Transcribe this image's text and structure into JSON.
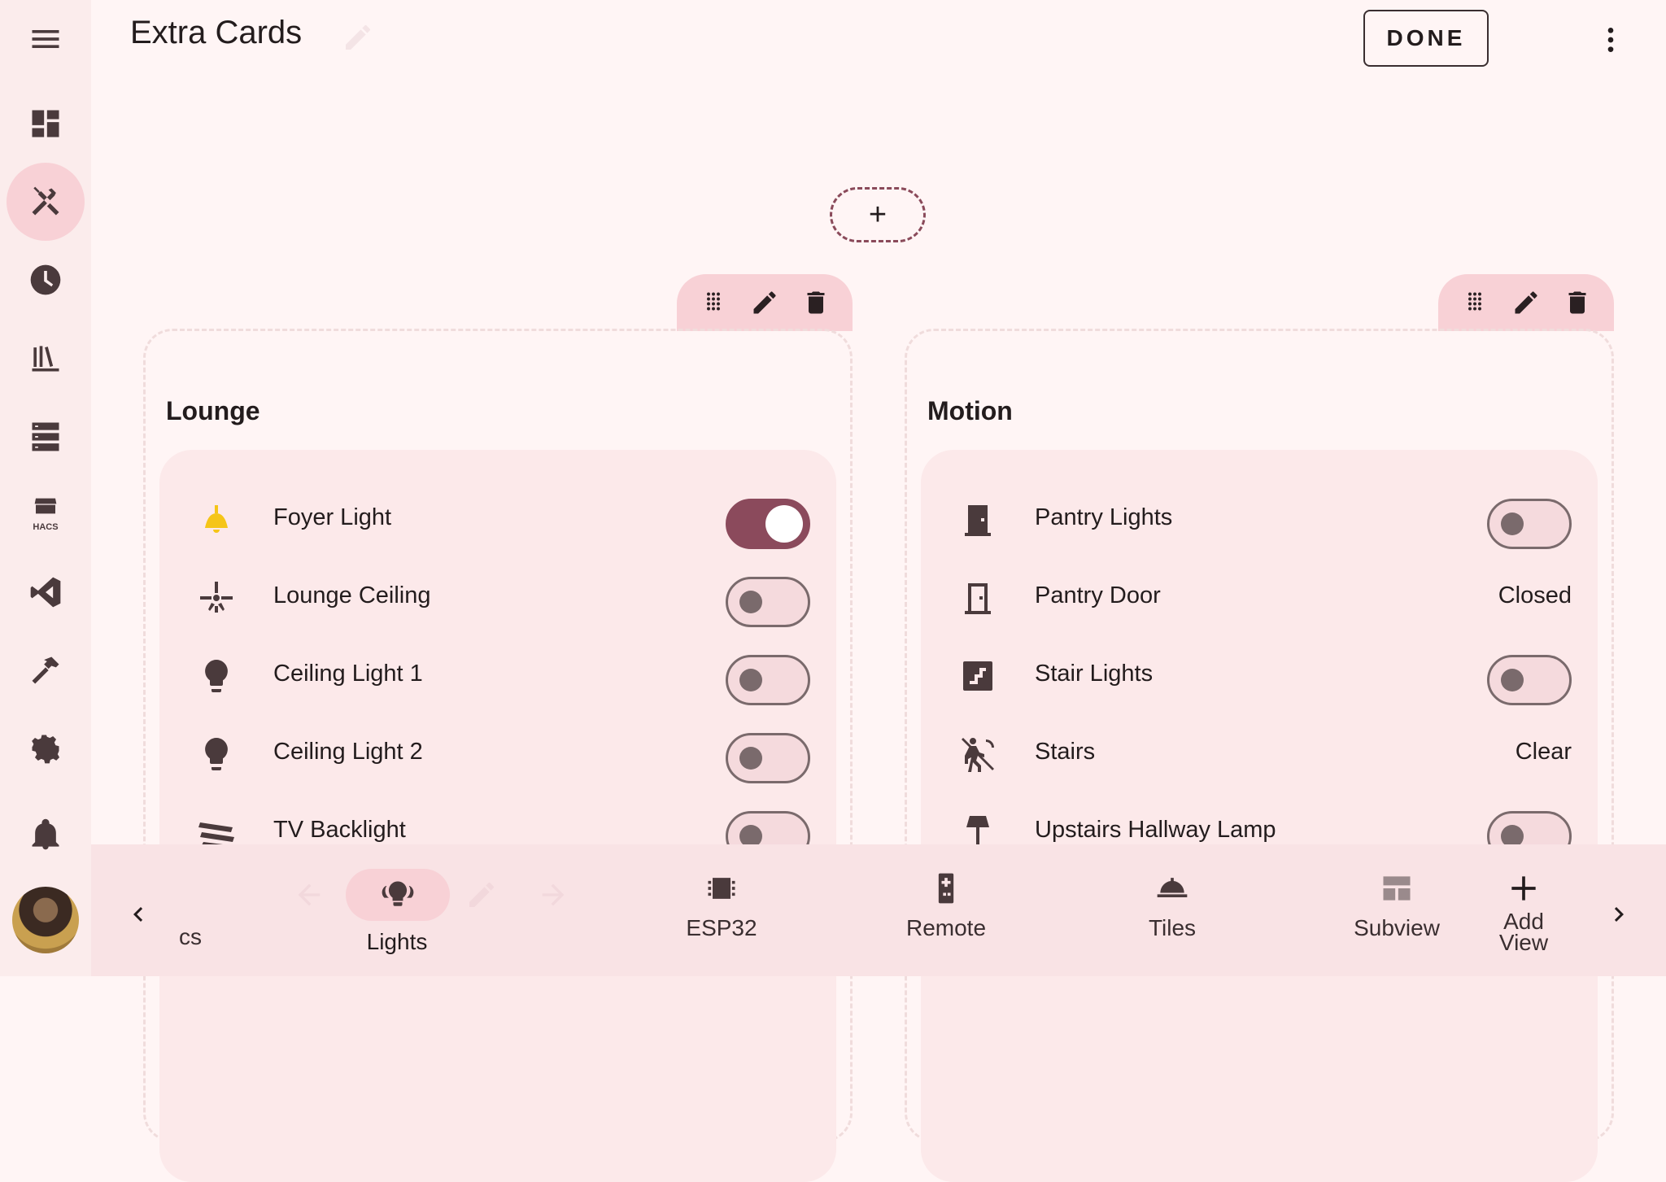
{
  "header": {
    "title": "Extra Cards",
    "done_label": "DONE"
  },
  "sidebar": {
    "items": [
      {
        "name": "menu-icon"
      },
      {
        "name": "overview-icon"
      },
      {
        "name": "developer-tools-icon",
        "active": true
      },
      {
        "name": "history-icon"
      },
      {
        "name": "library-icon"
      },
      {
        "name": "server-icon"
      },
      {
        "name": "hacs-icon",
        "label": "HACS"
      },
      {
        "name": "vscode-icon"
      },
      {
        "name": "hammer-icon"
      },
      {
        "name": "settings-icon"
      },
      {
        "name": "notifications-icon"
      }
    ]
  },
  "add_card": {
    "label": "+"
  },
  "cards": [
    {
      "title": "Lounge",
      "rows": [
        {
          "label": "Foyer Light",
          "icon": "ceiling-lamp-icon",
          "toggle": "on"
        },
        {
          "label": "Lounge Ceiling",
          "icon": "ceiling-fan-icon",
          "toggle": "off"
        },
        {
          "label": "Ceiling Light 1",
          "icon": "lightbulb-icon",
          "toggle": "off"
        },
        {
          "label": "Ceiling Light 2",
          "icon": "lightbulb-icon",
          "toggle": "off"
        },
        {
          "label": "TV Backlight",
          "icon": "led-strip-icon",
          "toggle": "off"
        }
      ]
    },
    {
      "title": "Motion",
      "rows": [
        {
          "label": "Pantry Lights",
          "icon": "door-closed-icon",
          "toggle": "off"
        },
        {
          "label": "Pantry Door",
          "icon": "door-icon",
          "state": "Closed"
        },
        {
          "label": "Stair Lights",
          "icon": "stairs-icon",
          "toggle": "off"
        },
        {
          "label": "Stairs",
          "icon": "motion-sensor-off-icon",
          "state": "Clear"
        },
        {
          "label": "Upstairs Hallway Lamp",
          "icon": "floor-lamp-icon",
          "toggle": "off"
        }
      ]
    }
  ],
  "bottom_tabs": {
    "partial_label": "cs",
    "lights": "Lights",
    "esp32": "ESP32",
    "remote": "Remote",
    "tiles": "Tiles",
    "subview": "Subview",
    "add_view_line1": "Add",
    "add_view_line2": "View"
  }
}
